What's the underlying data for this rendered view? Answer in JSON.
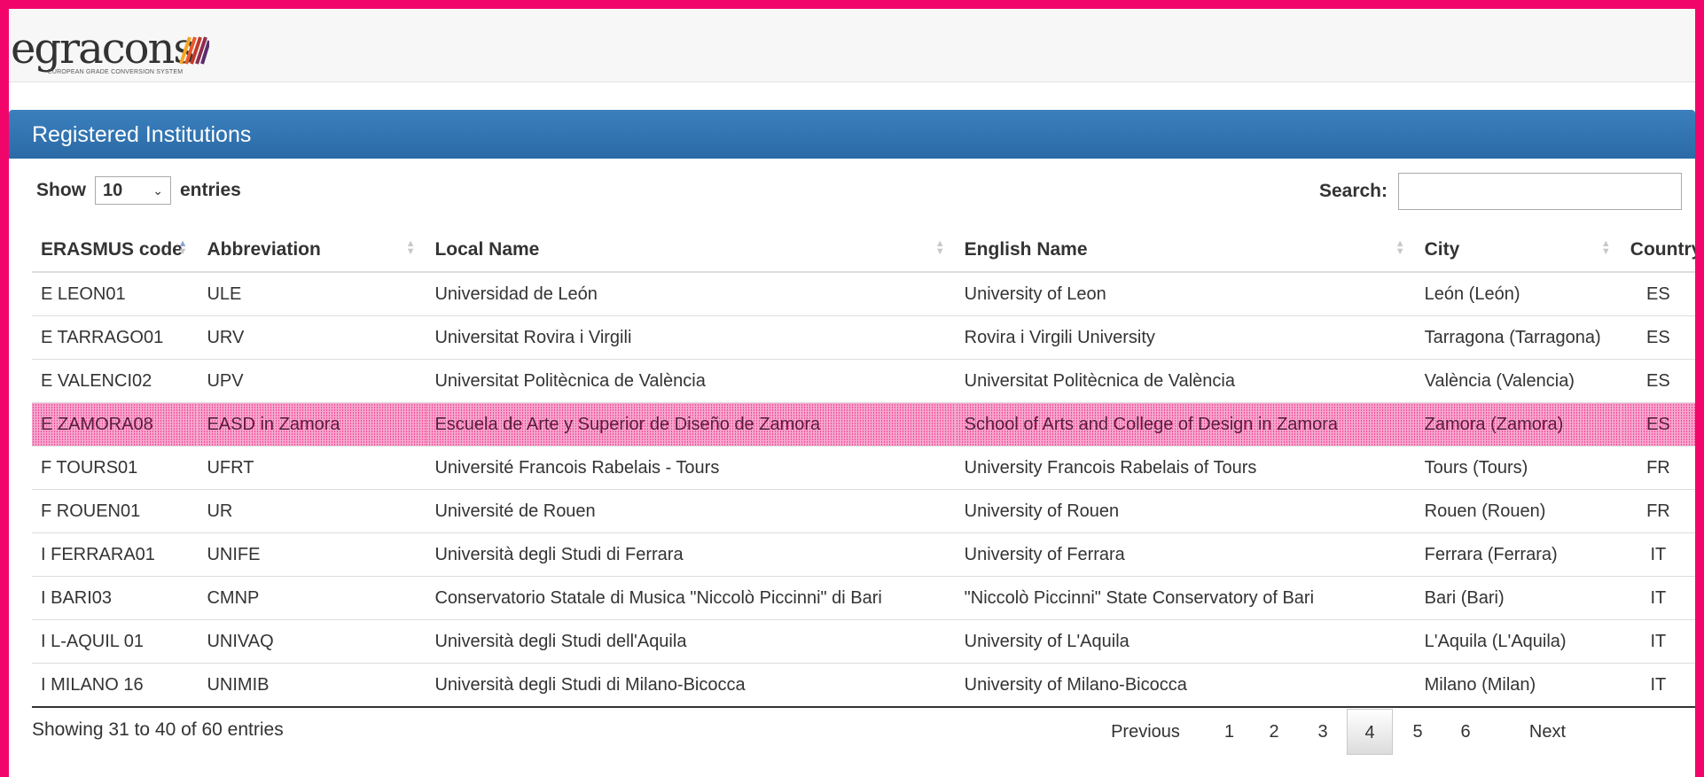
{
  "logo": {
    "word": "egracons",
    "sub": "EUROPEAN GRADE CONVERSION SYSTEM",
    "bar_colors": [
      "#f5a623",
      "#e8592a",
      "#c0392b",
      "#8e2d4f",
      "#5a2d6e"
    ]
  },
  "panel": {
    "title": "Registered Institutions"
  },
  "length": {
    "show": "Show",
    "value": "10",
    "entries": "entries"
  },
  "search": {
    "label": "Search:",
    "value": ""
  },
  "table": {
    "headers": [
      "ERASMUS code",
      "Abbreviation",
      "Local Name",
      "English Name",
      "City",
      "Country"
    ],
    "rows": [
      [
        "E LEON01",
        "ULE",
        "Universidad de León",
        "University of Leon",
        "León (León)",
        "ES"
      ],
      [
        "E TARRAGO01",
        "URV",
        "Universitat Rovira i Virgili",
        "Rovira i Virgili University",
        "Tarragona (Tarragona)",
        "ES"
      ],
      [
        "E VALENCI02",
        "UPV",
        "Universitat Politècnica de València",
        "Universitat Politècnica de València",
        "València (Valencia)",
        "ES"
      ],
      [
        "E ZAMORA08",
        "EASD in Zamora",
        "Escuela de Arte y Superior de Diseño de Zamora",
        "School of Arts and College of Design in Zamora",
        "Zamora (Zamora)",
        "ES"
      ],
      [
        "F TOURS01",
        "UFRT",
        "Université Francois Rabelais - Tours",
        "University Francois Rabelais of Tours",
        "Tours (Tours)",
        "FR"
      ],
      [
        "F ROUEN01",
        "UR",
        "Université de Rouen",
        "University of Rouen",
        "Rouen (Rouen)",
        "FR"
      ],
      [
        "I FERRARA01",
        "UNIFE",
        "Università degli Studi di Ferrara",
        "University of Ferrara",
        "Ferrara (Ferrara)",
        "IT"
      ],
      [
        "I BARI03",
        "CMNP",
        "Conservatorio Statale di Musica \"Niccolò Piccinni\" di Bari",
        "\"Niccolò Piccinni\" State Conservatory of Bari",
        "Bari (Bari)",
        "IT"
      ],
      [
        "I L-AQUIL 01",
        "UNIVAQ",
        "Università degli Studi dell'Aquila",
        "University of L'Aquila",
        "L'Aquila (L'Aquila)",
        "IT"
      ],
      [
        "I MILANO 16",
        "UNIMIB",
        "Università degli Studi di Milano-Bicocca",
        "University of Milano-Bicocca",
        "Milano (Milan)",
        "IT"
      ]
    ],
    "highlighted_row": 3
  },
  "info": "Showing 31 to 40 of 60 entries",
  "pagination": {
    "previous": "Previous",
    "pages": [
      "1",
      "2",
      "3",
      "4",
      "5",
      "6"
    ],
    "current": "4",
    "next": "Next"
  },
  "colors": {
    "frame": "#f2056b",
    "panel_header": "#2f73b0",
    "highlight": "#f6a7cf"
  }
}
